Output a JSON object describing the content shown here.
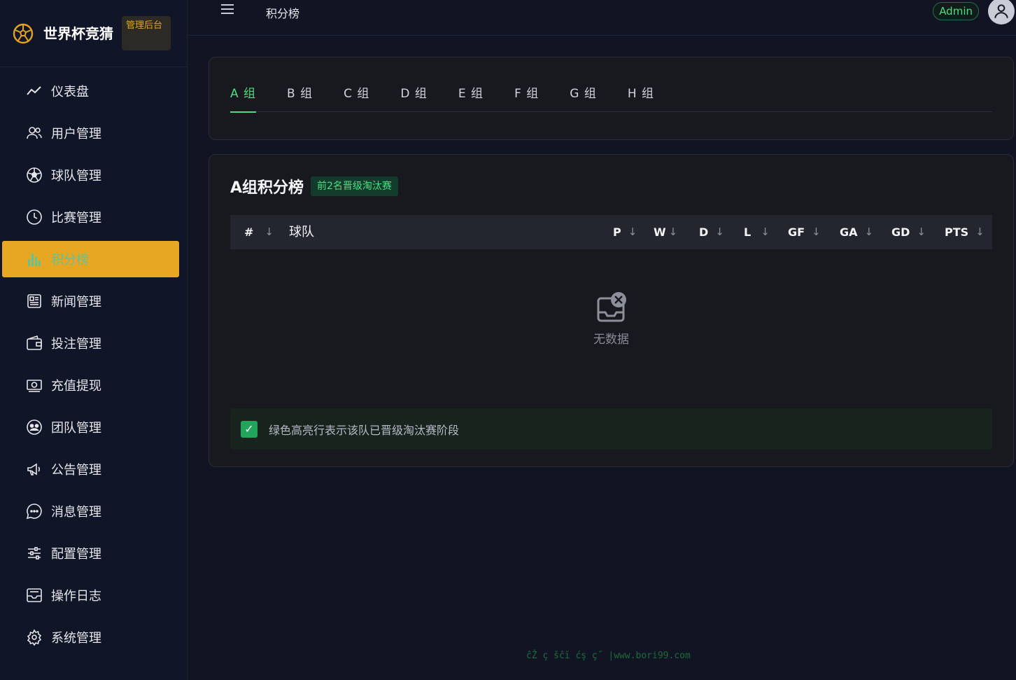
{
  "brand": {
    "title": "世界杯竞猜",
    "badge": "管理后台"
  },
  "sidebar": {
    "items": [
      {
        "label": "仪表盘",
        "icon": "chart-line-icon"
      },
      {
        "label": "用户管理",
        "icon": "users-icon"
      },
      {
        "label": "球队管理",
        "icon": "soccer-ball-icon"
      },
      {
        "label": "比赛管理",
        "icon": "clock-icon"
      },
      {
        "label": "积分榜",
        "icon": "bar-chart-icon",
        "active": true
      },
      {
        "label": "新闻管理",
        "icon": "newspaper-icon"
      },
      {
        "label": "投注管理",
        "icon": "wallet-icon"
      },
      {
        "label": "充值提现",
        "icon": "cash-icon"
      },
      {
        "label": "团队管理",
        "icon": "team-icon"
      },
      {
        "label": "公告管理",
        "icon": "megaphone-icon"
      },
      {
        "label": "消息管理",
        "icon": "chat-icon"
      },
      {
        "label": "配置管理",
        "icon": "sliders-icon"
      },
      {
        "label": "操作日志",
        "icon": "inbox-icon"
      },
      {
        "label": "系统管理",
        "icon": "gear-icon"
      }
    ]
  },
  "header": {
    "breadcrumb": "积分榜",
    "user_tag": "Admin"
  },
  "tabs": [
    "A 组",
    "B 组",
    "C 组",
    "D 组",
    "E 组",
    "F 组",
    "G 组",
    "H 组"
  ],
  "standings": {
    "title": "A组积分榜",
    "badge": "前2名晋级淘汰赛",
    "columns": {
      "rank": "#",
      "team": "球队",
      "p": "P",
      "w": "W",
      "d": "D",
      "l": "L",
      "gf": "GF",
      "ga": "GA",
      "gd": "GD",
      "pts": "PTS"
    },
    "sort_glyph": "↓",
    "empty_text": "无数据",
    "note": "绿色高亮行表示该队已晋级淘汰赛阶段",
    "note_check": "✓"
  },
  "footer": {
    "watermark": "ĉŽ ç šĉĭ ćş ç˝ |www.bori99.com"
  },
  "colors": {
    "accent": "#4ade80",
    "active_nav": "#e6a723",
    "background": "#111523"
  }
}
